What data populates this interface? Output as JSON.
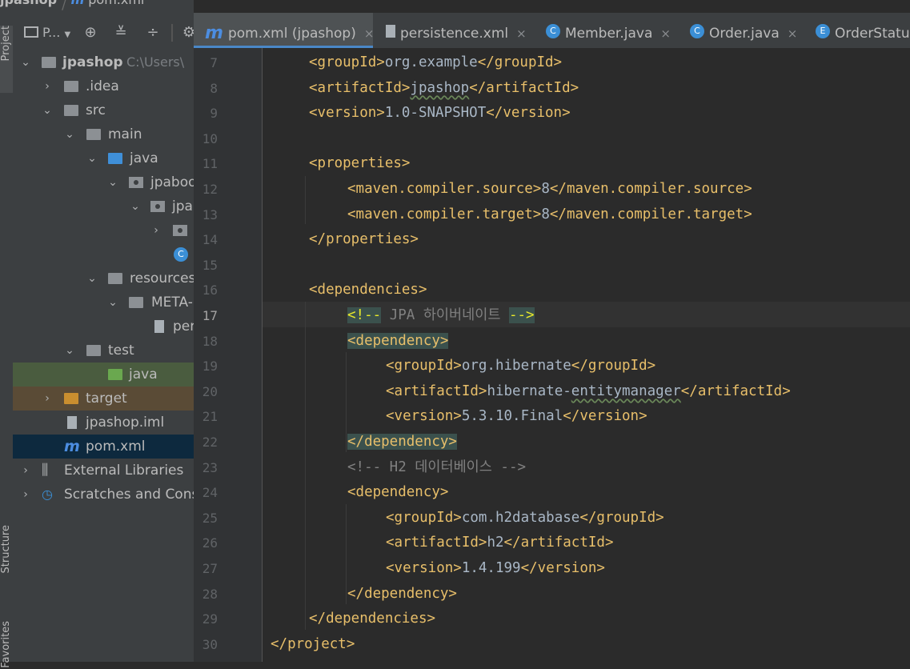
{
  "breadcrumb": {
    "project": "jpashop",
    "file": "pom.xml"
  },
  "side_tabs": {
    "project": "Project",
    "structure": "Structure",
    "favorites": "Favorites"
  },
  "toolbar": {
    "view_label": "P..."
  },
  "tree": {
    "root": {
      "name": "jpashop",
      "path": "C:\\Users\\"
    },
    "idea": ".idea",
    "src": "src",
    "main": "main",
    "java": "java",
    "pkg1": "jpabook",
    "pkg2": "jpa",
    "main_class_icon": "C",
    "resources": "resources",
    "meta": "META-INF",
    "persistence": "persistence.xml",
    "test": "test",
    "test_java": "java",
    "target": "target",
    "iml": "jpashop.iml",
    "pom": "pom.xml",
    "ext_libs": "External Libraries",
    "scratches": "Scratches and Consoles"
  },
  "tabs": [
    {
      "label": "pom.xml (jpashop)",
      "icon": "m"
    },
    {
      "label": "persistence.xml",
      "icon": "doc"
    },
    {
      "label": "Member.java",
      "icon": "C"
    },
    {
      "label": "Order.java",
      "icon": "C"
    },
    {
      "label": "OrderStatus",
      "icon": "E"
    }
  ],
  "editor": {
    "current_line": 17,
    "lines": [
      {
        "n": 7,
        "text": "<groupId>org.example</groupId>"
      },
      {
        "n": 8,
        "text": "<artifactId>jpashop</artifactId>"
      },
      {
        "n": 9,
        "text": "<version>1.0-SNAPSHOT</version>"
      },
      {
        "n": 10,
        "text": ""
      },
      {
        "n": 11,
        "text": "<properties>"
      },
      {
        "n": 12,
        "text": "<maven.compiler.source>8</maven.compiler.source>"
      },
      {
        "n": 13,
        "text": "<maven.compiler.target>8</maven.compiler.target>"
      },
      {
        "n": 14,
        "text": "</properties>"
      },
      {
        "n": 15,
        "text": ""
      },
      {
        "n": 16,
        "text": "<dependencies>"
      },
      {
        "n": 17,
        "text": "<!-- JPA 하이버네이트 -->"
      },
      {
        "n": 18,
        "text": "<dependency>"
      },
      {
        "n": 19,
        "text": "<groupId>org.hibernate</groupId>"
      },
      {
        "n": 20,
        "text": "<artifactId>hibernate-entitymanager</artifactId>"
      },
      {
        "n": 21,
        "text": "<version>5.3.10.Final</version>"
      },
      {
        "n": 22,
        "text": "</dependency>"
      },
      {
        "n": 23,
        "text": "<!-- H2 데이터베이스 -->"
      },
      {
        "n": 24,
        "text": "<dependency>"
      },
      {
        "n": 25,
        "text": "<groupId>com.h2database</groupId>"
      },
      {
        "n": 26,
        "text": "<artifactId>h2</artifactId>"
      },
      {
        "n": 27,
        "text": "<version>1.4.199</version>"
      },
      {
        "n": 28,
        "text": "</dependency>"
      },
      {
        "n": 29,
        "text": "</dependencies>"
      },
      {
        "n": 30,
        "text": "</project>"
      }
    ]
  }
}
